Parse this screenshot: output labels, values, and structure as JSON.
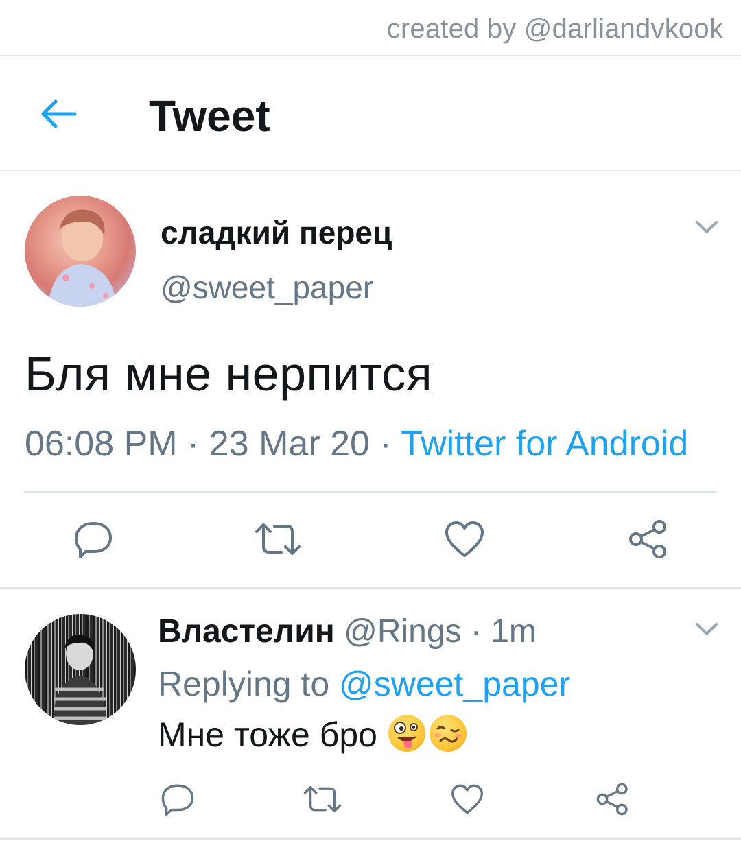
{
  "credit": "created by @darliandvkook",
  "header": {
    "title": "Tweet",
    "back_icon": "back-arrow-icon"
  },
  "main_tweet": {
    "display_name": "сладкий перец",
    "handle": "@sweet_paper",
    "text": "Бля мне нерпится",
    "time": "06:08 PM",
    "date": "23 Mar 20",
    "separator": " · ",
    "source": "Twitter for Android",
    "actions": [
      "reply-icon",
      "retweet-icon",
      "like-icon",
      "share-icon"
    ]
  },
  "reply_tweet": {
    "display_name": "Властелин",
    "handle": "@Rings",
    "time_ago": " · 1m",
    "replying_to_label": "Replying to ",
    "replying_to_handle": "@sweet_paper",
    "text": "Мне тоже бро ",
    "emojis": [
      "zany-face-emoji",
      "woozy-face-emoji"
    ],
    "actions": [
      "reply-icon",
      "retweet-icon",
      "like-icon",
      "share-icon"
    ]
  },
  "colors": {
    "accent": "#1da1f2",
    "secondary_text": "#657786",
    "divider": "#dfe4e8",
    "icon": "#657786"
  }
}
